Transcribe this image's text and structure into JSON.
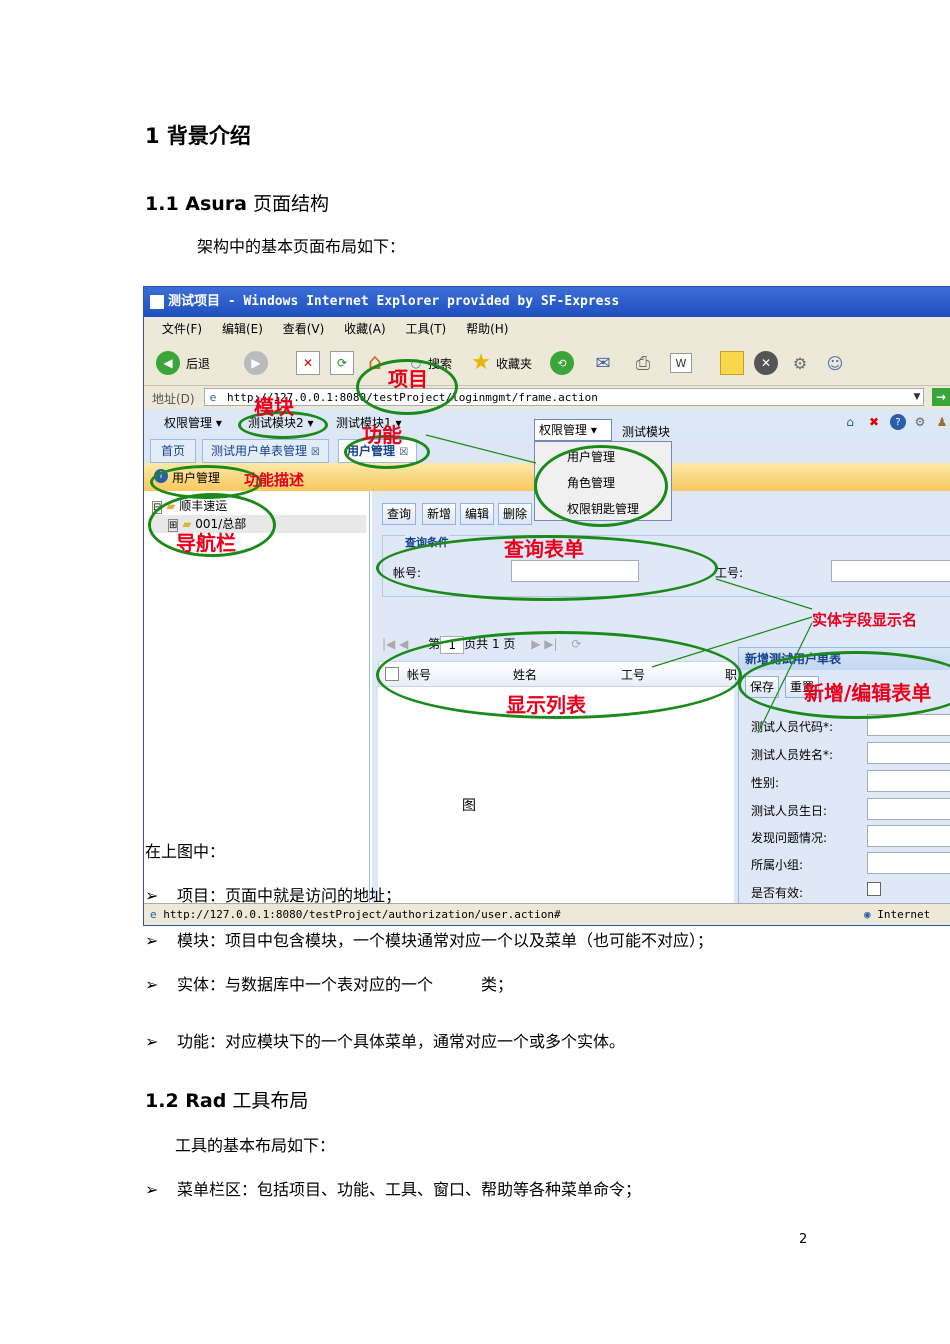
{
  "sections": {
    "s1_title": "1  背景介绍",
    "s1_1_title_bold": "1.1 Asura",
    "s1_1_title_rest": " 页面结构",
    "s1_1_intro": "架构中的基本页面布局如下：",
    "figure_label": "图",
    "after_fig": "在上图中：",
    "bullets1": [
      "项目：页面中就是访问的地址；",
      "模块：项目中包含模块，一个模块通常对应一个以及菜单（也可能不对应）；",
      "实体：与数据库中一个表对应的一个　　　类；",
      "功能：对应模块下的一个具体菜单，通常对应一个或多个实体。"
    ],
    "s1_2_title_bold": "1.2 Rad",
    "s1_2_title_rest": " 工具布局",
    "s1_2_intro": "工具的基本布局如下：",
    "bullets2": [
      "菜单栏区：包括项目、功能、工具、窗口、帮助等各种菜单命令；"
    ],
    "page_number": "2"
  },
  "screenshot": {
    "window_title": "测试项目 - Windows Internet Explorer provided by SF-Express",
    "menu": [
      "文件(F)",
      "编辑(E)",
      "查看(V)",
      "收藏(A)",
      "工具(T)",
      "帮助(H)"
    ],
    "toolbar": {
      "back": "后退",
      "search": "搜索",
      "favorites": "收藏夹"
    },
    "address_label": "地址(D)",
    "address_value": "http://127.0.0.1:8080/testProject/loginmgmt/frame.action",
    "app_menus": [
      "权限管理",
      "测试模块2",
      "测试模块1"
    ],
    "dropdown_title": "权限管理",
    "dropdown_side": "测试模块",
    "dropdown_items": [
      "用户管理",
      "角色管理",
      "权限钥匙管理"
    ],
    "tabs": [
      "首页",
      "测试用户单表管理",
      "用户管理"
    ],
    "breadcrumb": "用户管理",
    "tree": {
      "root": "顺丰速运",
      "child": "001/总部"
    },
    "actions": [
      "查询",
      "新增",
      "编辑",
      "删除"
    ],
    "query_legend": "查询条件",
    "query_fields": [
      "帐号:",
      "工号:"
    ],
    "pager": {
      "page_prefix": "第",
      "page_value": "1",
      "page_suffix": "页共 1 页"
    },
    "grid_columns": [
      "帐号",
      "姓名",
      "工号",
      "职"
    ],
    "form_title": "新增测试用户单表",
    "form_buttons": [
      "保存",
      "重置"
    ],
    "form_fields": [
      "测试人员代码*:",
      "测试人员姓名*:",
      "性别:",
      "测试人员生日:",
      "发现问题情况:",
      "所属小组:",
      "是否有效:"
    ],
    "status_url": "http://127.0.0.1:8080/testProject/authorization/user.action#",
    "status_zone": "Internet",
    "annotations": {
      "project": "项目",
      "module": "模块",
      "function": "功能",
      "function_desc": "功能描述",
      "nav": "导航栏",
      "query_form": "查询表单",
      "entity_field": "实体字段显示名",
      "display_list": "显示列表",
      "edit_form": "新增/编辑表单"
    }
  }
}
